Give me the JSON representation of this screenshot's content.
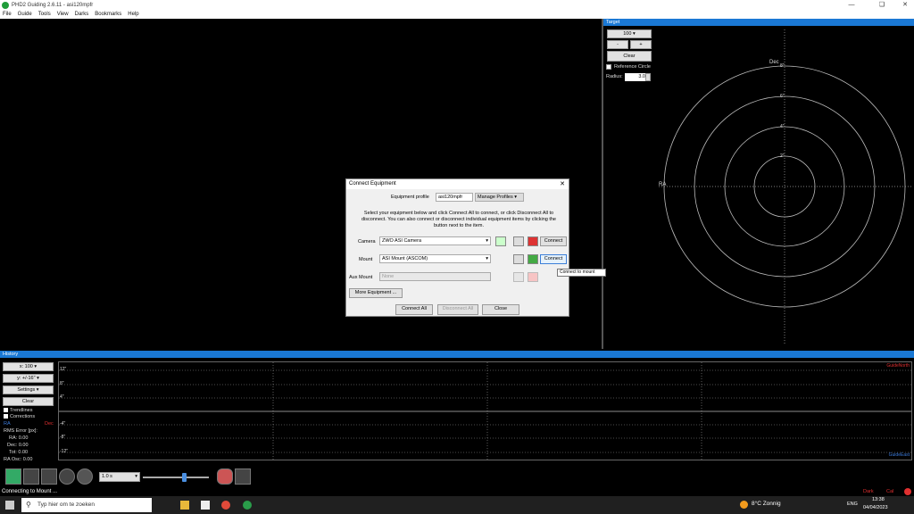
{
  "window": {
    "title": "PHD2 Guiding 2.6.11 - asi120mpfr"
  },
  "menu": [
    "File",
    "Guide",
    "Tools",
    "View",
    "Darks",
    "Bookmarks",
    "Help"
  ],
  "target": {
    "header": "Target",
    "zoom": "100",
    "minus": "-",
    "plus": "+",
    "clear": "Clear",
    "reference_circle": "Reference Circle",
    "radius_label": "Radius:",
    "radius_value": "3.0",
    "dec_label": "Dec",
    "ra_label": "RA",
    "ticks": [
      "8\"",
      "6\"",
      "4\"",
      "2\""
    ]
  },
  "dialog": {
    "title": "Connect Equipment",
    "profile_label": "Equipment profile",
    "profile_value": "asi120mpfr",
    "manage_profiles": "Manage Profiles",
    "instructions": "Select your equipment below and click Connect All to connect, or click Disconnect All to disconnect. You can also connect or disconnect individual equipment items by clicking the button next to the item.",
    "camera_label": "Camera",
    "camera_value": "ZWO ASI Camera",
    "mount_label": "Mount",
    "mount_value": "ASI Mount (ASCOM)",
    "aux_label": "Aux Mount",
    "aux_value": "None",
    "connect": "Connect",
    "tooltip": "Connect to mount",
    "more_equipment": "More Equipment ...",
    "connect_all": "Connect All",
    "disconnect_all": "Disconnect All",
    "close": "Close"
  },
  "history": {
    "header": "History",
    "x_combo": "x: 100",
    "y_combo": "y: +/-16\"",
    "settings": "Settings",
    "clear": "Clear",
    "trendlines": "Trendlines",
    "corrections": "Corrections",
    "ra": "RA",
    "dec": "Dec",
    "rms_title": "RMS Error [px]:",
    "rms_ra": "RA: 0.00",
    "rms_dec": "Dec: 0.00",
    "rms_tot": "Tot: 0.00",
    "ra_osc": "RA Osc: 0.00",
    "y_ticks": [
      "12\"",
      "8\"",
      "4\"",
      "-4\"",
      "-8\"",
      "-12\""
    ],
    "guide_north": "GuideNorth",
    "guide_east": "GuideEast"
  },
  "toolbar": {
    "exposure": "1.0 s"
  },
  "status": {
    "message": "Connecting to Mount ...",
    "dark": "Dark",
    "cal": "Cal"
  },
  "taskbar": {
    "search": "Typ hier om te zoeken",
    "weather": "8°C Zonnig",
    "lang": "ENG",
    "time": "13:38",
    "date": "04/04/2023"
  }
}
